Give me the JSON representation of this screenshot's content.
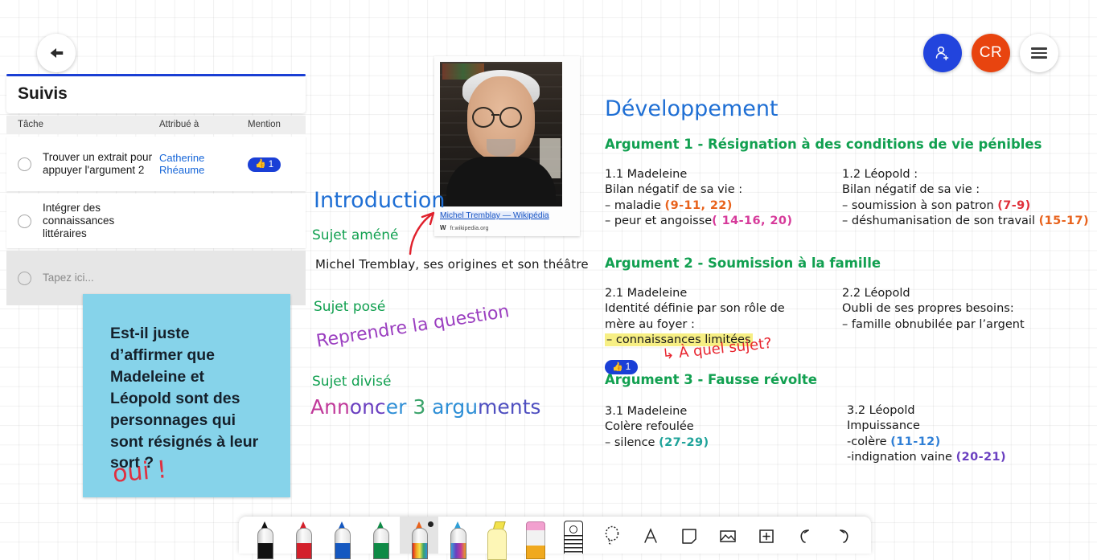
{
  "header": {
    "back_icon": "arrow-left-icon",
    "share_icon": "add-person-icon",
    "avatar_initials": "CR",
    "menu_icon": "hamburger-menu-icon"
  },
  "suivis": {
    "title": "Suivis",
    "columns": {
      "task": "Tâche",
      "assignee": "Attribué à",
      "mention": "Mention"
    },
    "rows": [
      {
        "label": "Trouver un extrait pour appuyer l'argument 2",
        "assignee": "Catherine Rhéaume",
        "mention": "1"
      },
      {
        "label": "Intégrer des connaissances littéraires",
        "assignee": "",
        "mention": ""
      }
    ],
    "new_task_placeholder": "Tapez ici...",
    "accent_color": "#1a3fd6"
  },
  "sticky_note": {
    "text": "Est-il juste d’affirmer que Madeleine et Léopold sont des personnages qui sont résignés à leur sort ?",
    "background_color": "#86d3ea",
    "annotation": "oui !",
    "annotation_color": "#e03040"
  },
  "wiki_card": {
    "title": "Michel Tremblay — Wikipédia",
    "source": "fr.wikipedia.org",
    "source_mark": "W",
    "image_alt": "portrait-photo"
  },
  "introduction": {
    "heading": "Introduction",
    "label_amene": "Sujet améné",
    "line_amene": "Michel Tremblay, ses origines et son théâtre",
    "label_pose": "Sujet posé",
    "note_pose": "Reprendre la question",
    "label_divise": "Sujet divisé",
    "note_divise_parts": [
      "Ann",
      "onc",
      "er",
      "3",
      "argu",
      "ments"
    ],
    "arrow_icon": "curved-arrow-icon"
  },
  "development": {
    "heading": "Développement",
    "arguments": [
      {
        "heading": "Argument 1 - Résignation à des conditions de vie pénibles",
        "left": {
          "title": "1.1 Madeleine",
          "subtitle": "Bilan négatif de sa vie :",
          "items": [
            {
              "text": "– maladie",
              "ref": "(9-11, 22)"
            },
            {
              "text": "– peur et angoisse",
              "ref": "( 14-16, 20)"
            }
          ]
        },
        "right": {
          "title": "1.2 Léopold :",
          "subtitle": "Bilan négatif de sa vie :",
          "items": [
            {
              "text": "– soumission à son patron",
              "ref": "(7-9)"
            },
            {
              "text": "– déshumanisation de son travail",
              "ref": "(15-17)"
            }
          ]
        }
      },
      {
        "heading": "Argument 2 - Soumission à la famille",
        "left": {
          "title": "2.1 Madeleine",
          "subtitle": "Identité définie par son rôle de mère au foyer :",
          "items": [
            {
              "text": "– connaissances limitées",
              "ref": "",
              "highlighted": true
            }
          ]
        },
        "right": {
          "title": "2.2 Léopold",
          "subtitle": "Oubli de ses propres besoins:",
          "items": [
            {
              "text": "– famille obnubilée par l’argent",
              "ref": ""
            }
          ]
        },
        "annotation": "↳ À quel sujet?",
        "mention_count": "1"
      },
      {
        "heading": "Argument 3 - Fausse révolte",
        "left": {
          "title": "3.1 Madeleine",
          "subtitle": "Colère refoulée",
          "items": [
            {
              "text": "– silence",
              "ref": "(27-29)"
            }
          ]
        },
        "right": {
          "title": "3.2 Léopold",
          "subtitle": "Impuissance",
          "items": [
            {
              "text": "-colère",
              "ref": "(11-12)"
            },
            {
              "text": "-indignation vaine",
              "ref": "(20-21)"
            }
          ]
        }
      }
    ]
  },
  "toolbar": {
    "tools": [
      {
        "name": "pen-black",
        "color": "#111111"
      },
      {
        "name": "pen-red",
        "color": "#d3202b"
      },
      {
        "name": "pen-blue",
        "color": "#1558c0"
      },
      {
        "name": "pen-green",
        "color": "#0f8a46"
      },
      {
        "name": "pen-rainbow",
        "color": "rainbow",
        "selected": true
      },
      {
        "name": "pen-galaxy",
        "color": "galaxy"
      },
      {
        "name": "highlighter-yellow",
        "color": "#f2e24c"
      },
      {
        "name": "eraser",
        "color": "#f2a0cf"
      },
      {
        "name": "ruler",
        "color": "#222222"
      },
      {
        "name": "lasso-select",
        "color": "#222222"
      },
      {
        "name": "text-tool",
        "color": "#222222"
      },
      {
        "name": "sticky-note-tool",
        "color": "#222222"
      },
      {
        "name": "insert-image",
        "color": "#222222"
      },
      {
        "name": "insert-shape",
        "color": "#222222"
      },
      {
        "name": "undo",
        "color": "#222222"
      },
      {
        "name": "redo",
        "color": "#222222"
      }
    ]
  }
}
